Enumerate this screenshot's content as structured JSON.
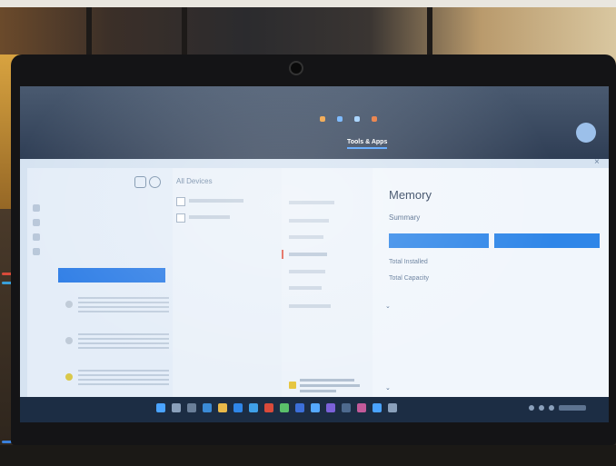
{
  "browser": {
    "tabs": [
      "",
      "",
      ""
    ],
    "bookmarks": [
      "",
      "",
      "",
      ""
    ],
    "nav": [
      {
        "label": "Tools & Apps",
        "active": true
      },
      {
        "label": "",
        "active": false
      },
      {
        "label": "",
        "active": false
      }
    ]
  },
  "sidebar": {
    "items": [
      "",
      "",
      "",
      ""
    ],
    "primary_button": ""
  },
  "middle": {
    "title": "All Devices"
  },
  "memory": {
    "title": "Memory",
    "summary_label": "Summary",
    "rows": [
      {
        "label": "Total Installed",
        "value": ""
      },
      {
        "label": "Total Capacity",
        "value": ""
      }
    ],
    "slots": [
      {
        "label": "",
        "details": [
          "",
          "",
          ""
        ]
      },
      {
        "label": "",
        "details": []
      }
    ]
  },
  "colors": {
    "accent": "#2f86e8",
    "taskbar": "#1c2d44"
  }
}
